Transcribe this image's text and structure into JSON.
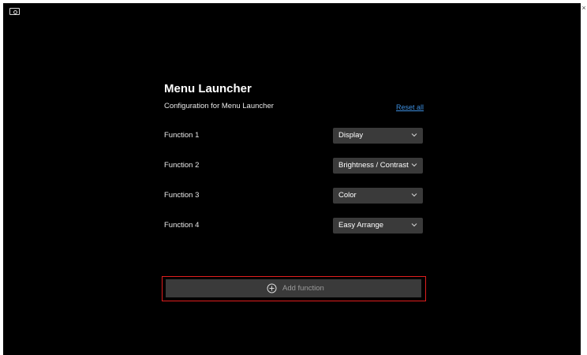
{
  "window": {
    "close_glyph": "×",
    "app_icon": "monitor-icon"
  },
  "panel": {
    "title": "Menu Launcher",
    "subtitle": "Configuration for Menu Launcher",
    "reset_label": "Reset all"
  },
  "functions": [
    {
      "label": "Function 1",
      "value": "Display"
    },
    {
      "label": "Function 2",
      "value": "Brightness / Contrast"
    },
    {
      "label": "Function 3",
      "value": "Color"
    },
    {
      "label": "Function 4",
      "value": "Easy Arrange"
    }
  ],
  "add_function": {
    "label": "Add function",
    "icon": "plus-circle-icon"
  },
  "colors": {
    "background": "#000000",
    "control": "#3a3a3a",
    "link": "#3d8fe0",
    "highlight": "#e01e1e"
  }
}
